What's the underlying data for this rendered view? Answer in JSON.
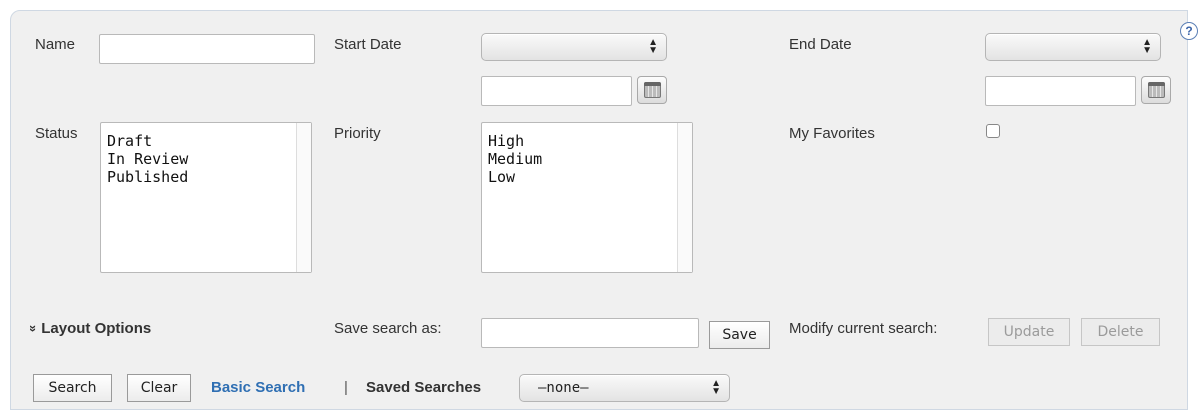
{
  "help": {
    "icon": "?"
  },
  "fields": {
    "name": {
      "label": "Name",
      "value": ""
    },
    "start_date": {
      "label": "Start Date",
      "select_value": "",
      "date_value": ""
    },
    "end_date": {
      "label": "End Date",
      "select_value": "",
      "date_value": ""
    },
    "status": {
      "label": "Status",
      "options": [
        "Draft",
        "In Review",
        "Published"
      ]
    },
    "priority": {
      "label": "Priority",
      "options": [
        "High",
        "Medium",
        "Low"
      ]
    },
    "my_favorites": {
      "label": "My Favorites",
      "checked": false
    }
  },
  "layout_options": {
    "arrow": "»",
    "label": "Layout Options"
  },
  "save_search": {
    "label": "Save search as:",
    "value": "",
    "button": "Save"
  },
  "modify_search": {
    "label": "Modify current search:",
    "update": "Update",
    "delete": "Delete"
  },
  "footer": {
    "search": "Search",
    "clear": "Clear",
    "basic_search": "Basic Search",
    "separator": "|",
    "saved_searches_label": "Saved Searches",
    "saved_searches_value": "–none–"
  },
  "colors": {
    "link": "#2f6fb3",
    "panel": "#f0f0f0"
  }
}
